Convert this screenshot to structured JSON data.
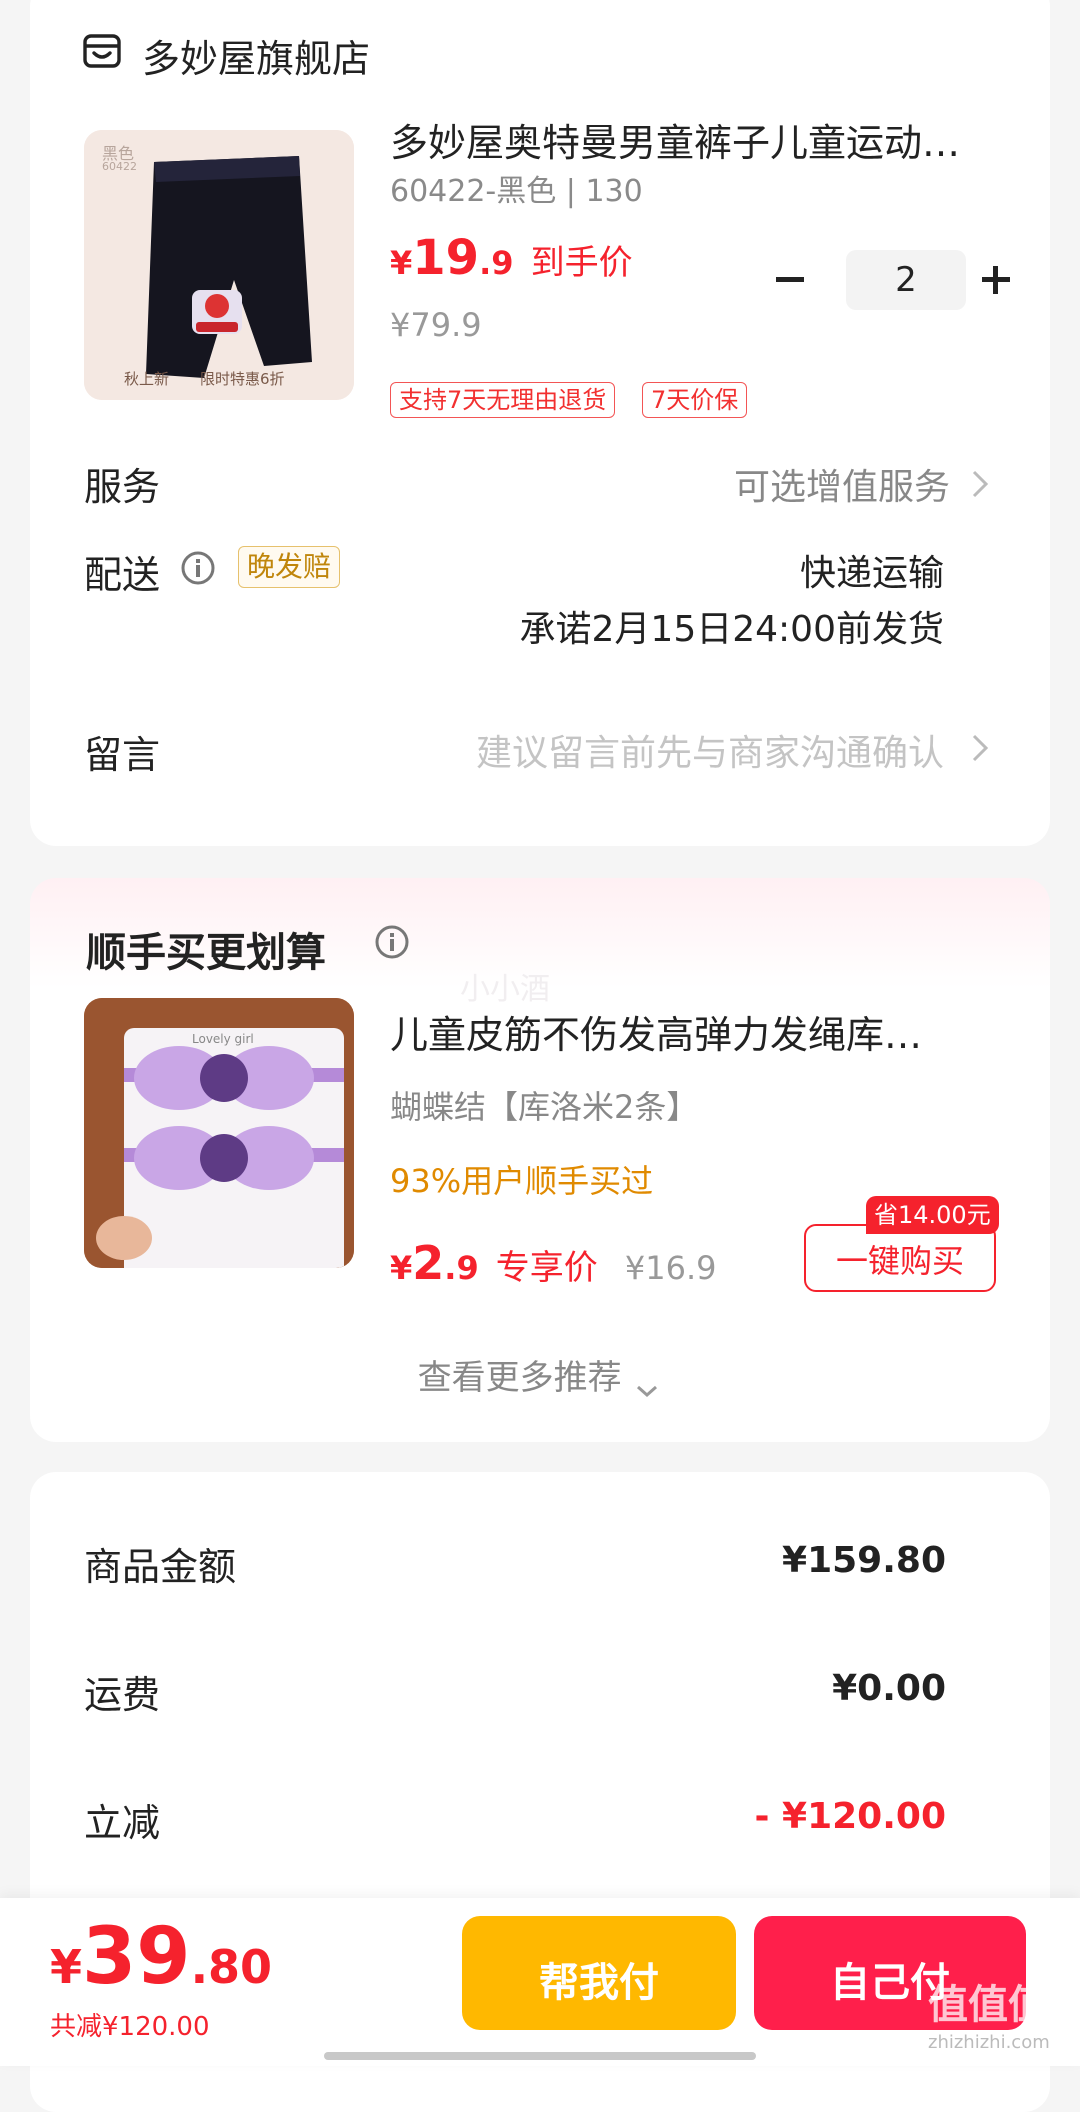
{
  "store": {
    "name": "多妙屋旗舰店",
    "icon": "store-icon"
  },
  "product": {
    "title": "多妙屋奥特曼男童裤子儿童运动…",
    "sku": "60422-黑色 | 130",
    "price_symbol": "¥",
    "price_int": "19",
    "price_dec": ".9",
    "price_label": "到手价",
    "original_price": "¥79.9",
    "quantity": "2",
    "tags": [
      "支持7天无理由退货",
      "7天价保"
    ],
    "image_text": {
      "top": "黑色",
      "code": "60422",
      "left": "秋上新",
      "right": "限时特惠6折"
    }
  },
  "rows": {
    "service_label": "服务",
    "service_value": "可选增值服务",
    "delivery_label": "配送",
    "delivery_badge": "晚发赔",
    "delivery_method": "快递运输",
    "delivery_promise": "承诺2月15日24:00前发货",
    "message_label": "留言",
    "message_placeholder": "建议留言前先与商家沟通确认"
  },
  "addon": {
    "title": "顺手买更划算",
    "watermark": "小小酒",
    "product_title": "儿童皮筋不伤发高弹力发绳库…",
    "sku": "蝴蝶结【库洛米2条】",
    "social_proof": "93%用户顺手买过",
    "price_symbol": "¥",
    "price_int": "2",
    "price_dec": ".9",
    "price_label": "专享价",
    "original_price": "¥16.9",
    "save_badge": "省14.00元",
    "buy_button": "一键购买",
    "more": "查看更多推荐",
    "image_text": "Lovely girl"
  },
  "summary": {
    "goods_label": "商品金额",
    "goods_value": "¥159.80",
    "shipping_label": "运费",
    "shipping_value": "¥0.00",
    "discount_label": "立减",
    "discount_value": "- ¥120.00"
  },
  "bottom": {
    "total_symbol": "¥",
    "total_int": "39",
    "total_dec": ".80",
    "total_discount": "共减¥120.00",
    "help_pay": "帮我付",
    "self_pay": "自己付",
    "watermark": "值值值",
    "watermark_url": "zhizhizhi.com"
  },
  "colors": {
    "accent_red": "#f5222d",
    "help_pay": "#ffb800",
    "self_pay": "#ff1f4b",
    "orange_text": "#e08a00"
  }
}
